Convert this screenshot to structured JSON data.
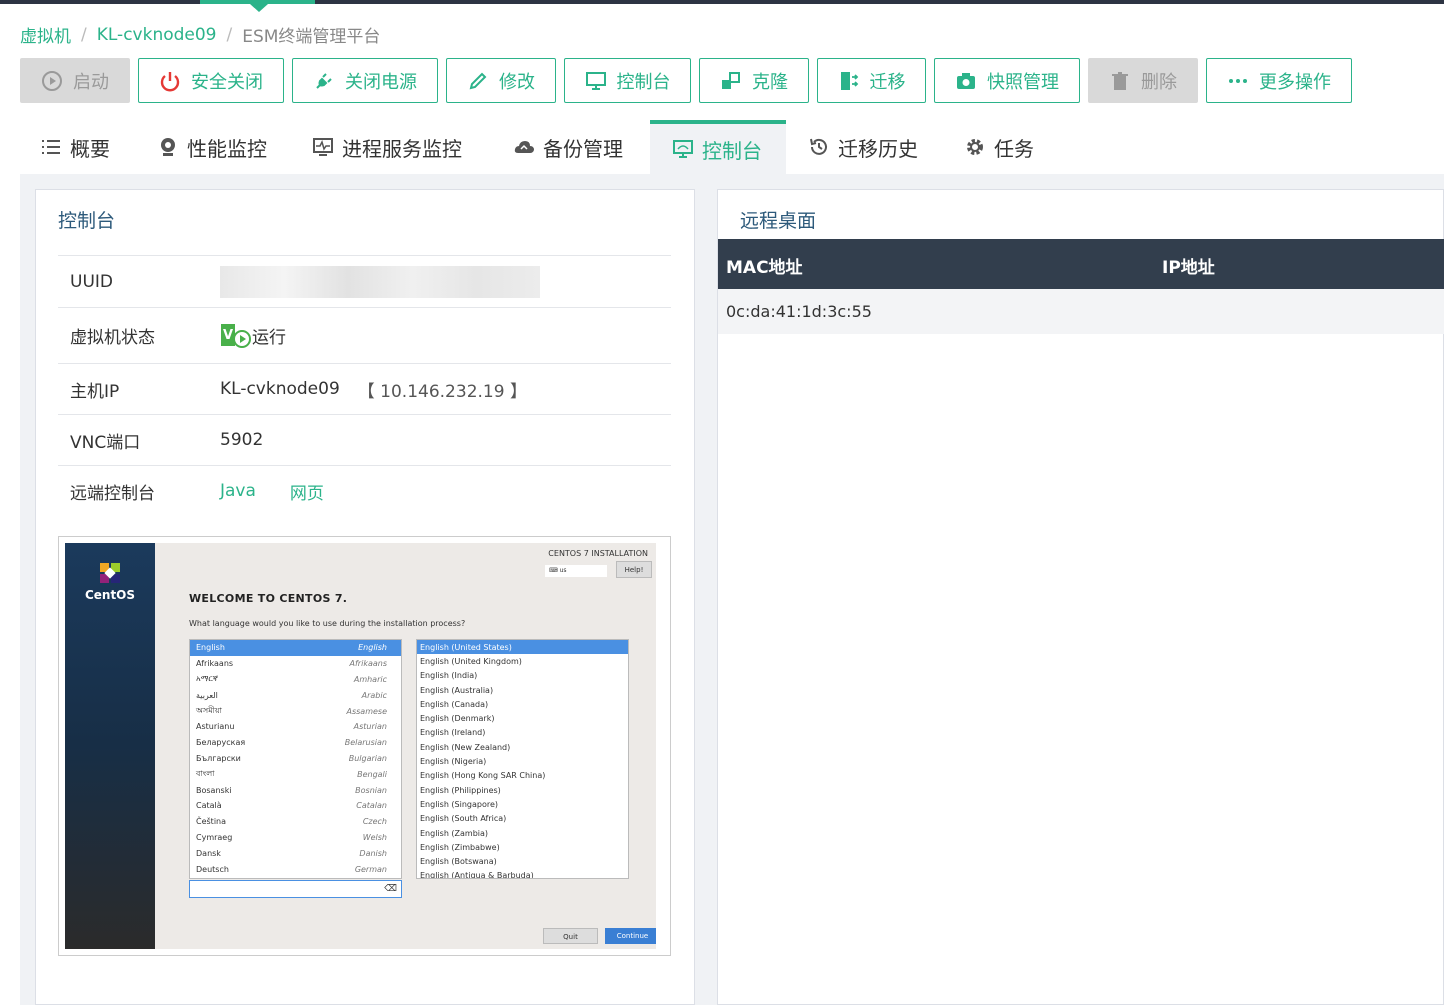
{
  "breadcrumb": {
    "items": [
      "虚拟机",
      "KL-cvknode09"
    ],
    "current": "ESM终端管理平台"
  },
  "toolbar": {
    "start": "启动",
    "safe_shutdown": "安全关闭",
    "power_off": "关闭电源",
    "edit": "修改",
    "console": "控制台",
    "clone": "克隆",
    "migrate": "迁移",
    "snapshot": "快照管理",
    "delete": "删除",
    "more": "更多操作"
  },
  "tabs": [
    "概要",
    "性能监控",
    "进程服务监控",
    "备份管理",
    "控制台",
    "迁移历史",
    "任务"
  ],
  "active_tab": "控制台",
  "console_panel": {
    "title": "控制台",
    "uuid_label": "UUID",
    "status_label": "虚拟机状态",
    "status_value": "运行",
    "host_ip_label": "主机IP",
    "host_name": "KL-cvknode09",
    "host_ip": "【 10.146.232.19 】",
    "vnc_port_label": "VNC端口",
    "vnc_port": "5902",
    "remote_console_label": "远端控制台",
    "links": [
      "Java",
      "网页"
    ]
  },
  "vm_screen": {
    "logo": "CentOS",
    "header": "CENTOS 7 INSTALLATION",
    "keyboard": "us",
    "help": "Help!",
    "welcome": "WELCOME TO CENTOS 7.",
    "question": "What language would you like to use during the installation process?",
    "languages": [
      [
        "English",
        "English"
      ],
      [
        "Afrikaans",
        "Afrikaans"
      ],
      [
        "አማርኛ",
        "Amharic"
      ],
      [
        "العربية",
        "Arabic"
      ],
      [
        "অসমীয়া",
        "Assamese"
      ],
      [
        "Asturianu",
        "Asturian"
      ],
      [
        "Беларуская",
        "Belarusian"
      ],
      [
        "Български",
        "Bulgarian"
      ],
      [
        "বাংলা",
        "Bengali"
      ],
      [
        "Bosanski",
        "Bosnian"
      ],
      [
        "Català",
        "Catalan"
      ],
      [
        "Čeština",
        "Czech"
      ],
      [
        "Cymraeg",
        "Welsh"
      ],
      [
        "Dansk",
        "Danish"
      ],
      [
        "Deutsch",
        "German"
      ]
    ],
    "locales": [
      "English (United States)",
      "English (United Kingdom)",
      "English (India)",
      "English (Australia)",
      "English (Canada)",
      "English (Denmark)",
      "English (Ireland)",
      "English (New Zealand)",
      "English (Nigeria)",
      "English (Hong Kong SAR China)",
      "English (Philippines)",
      "English (Singapore)",
      "English (South Africa)",
      "English (Zambia)",
      "English (Zimbabwe)",
      "English (Botswana)",
      "English (Antigua & Barbuda)"
    ],
    "quit": "Quit",
    "continue": "Continue"
  },
  "remote_desktop": {
    "title": "远程桌面",
    "columns": [
      "MAC地址",
      "IP地址"
    ],
    "rows": [
      [
        "0c:da:41:1d:3c:55",
        ""
      ]
    ]
  },
  "colors": {
    "accent": "#2bb38a",
    "header_dark": "#323e4d",
    "title_blue": "#2d5a7b"
  }
}
